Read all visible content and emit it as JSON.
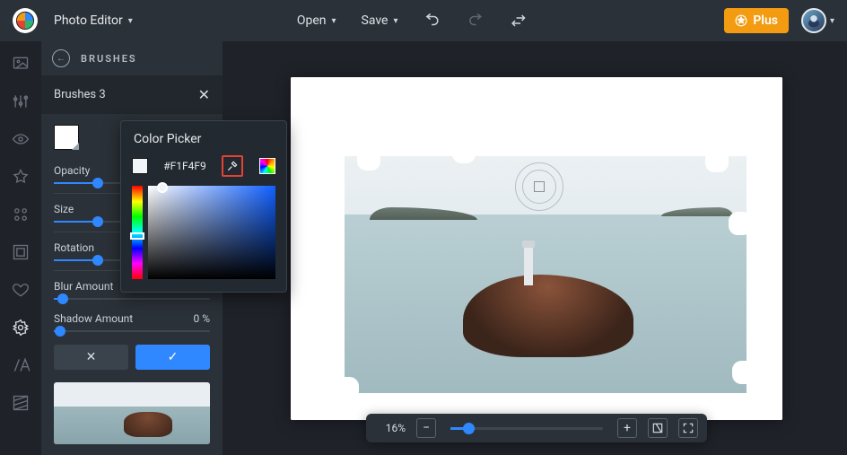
{
  "header": {
    "app_title": "Photo Editor",
    "open_label": "Open",
    "save_label": "Save",
    "plus_label": "Plus"
  },
  "sidebar": {
    "title": "BRUSHES",
    "brush_name": "Brushes 3",
    "color_picker_title": "Color Picker",
    "hex_value": "#F1F4F9",
    "sliders": {
      "opacity": {
        "label": "Opacity",
        "value": ""
      },
      "size": {
        "label": "Size",
        "value": ""
      },
      "rotation": {
        "label": "Rotation",
        "value": ""
      },
      "blur": {
        "label": "Blur Amount",
        "value": ""
      },
      "shadow": {
        "label": "Shadow Amount",
        "value": "0 %"
      }
    }
  },
  "toolbar": {
    "zoom": "16%"
  },
  "colors": {
    "accent": "#2f88ff",
    "plus": "#f39c12",
    "eyedrop_highlight": "#e34234",
    "current_swatch": "#F1F4F9"
  }
}
